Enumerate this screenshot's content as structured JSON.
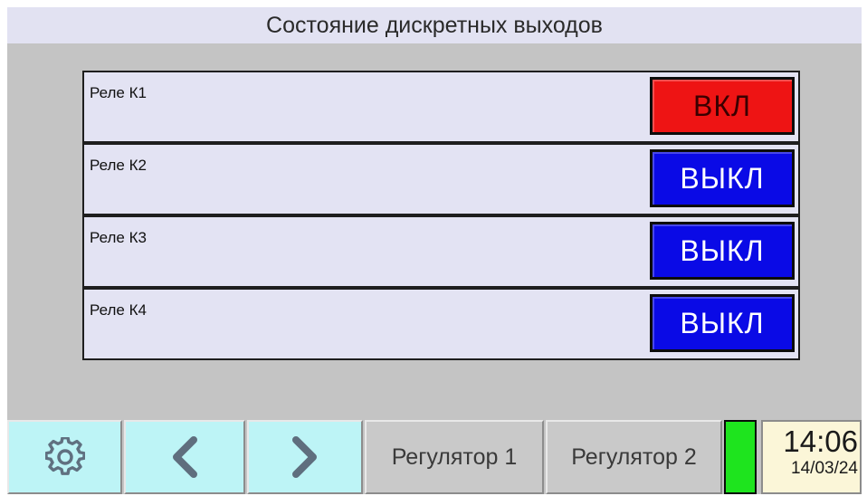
{
  "header": {
    "title": "Состояние дискретных выходов"
  },
  "relays": [
    {
      "label": "Реле К1",
      "state": "ВКЛ",
      "state_color": "#ee1414"
    },
    {
      "label": "Реле К2",
      "state": "ВЫКЛ",
      "state_color": "#0a0ae6"
    },
    {
      "label": "Реле К3",
      "state": "ВЫКЛ",
      "state_color": "#0a0ae6"
    },
    {
      "label": "Реле К4",
      "state": "ВЫКЛ",
      "state_color": "#0a0ae6"
    }
  ],
  "navigation": {
    "settings_icon": "gear-icon",
    "prev_icon": "chevron-left-icon",
    "next_icon": "chevron-right-icon",
    "regulator1_label": "Регулятор 1",
    "regulator2_label": "Регулятор 2",
    "status_led_color": "#1ee41e"
  },
  "clock": {
    "time": "14:06",
    "date": "14/03/24"
  },
  "colors": {
    "screen_background": "#c4c4c4",
    "title_background": "#e2e2f2",
    "row_background": "#e3e3f3",
    "nav_cyan": "#bdf4f6",
    "clock_background": "#fbf6d8"
  }
}
